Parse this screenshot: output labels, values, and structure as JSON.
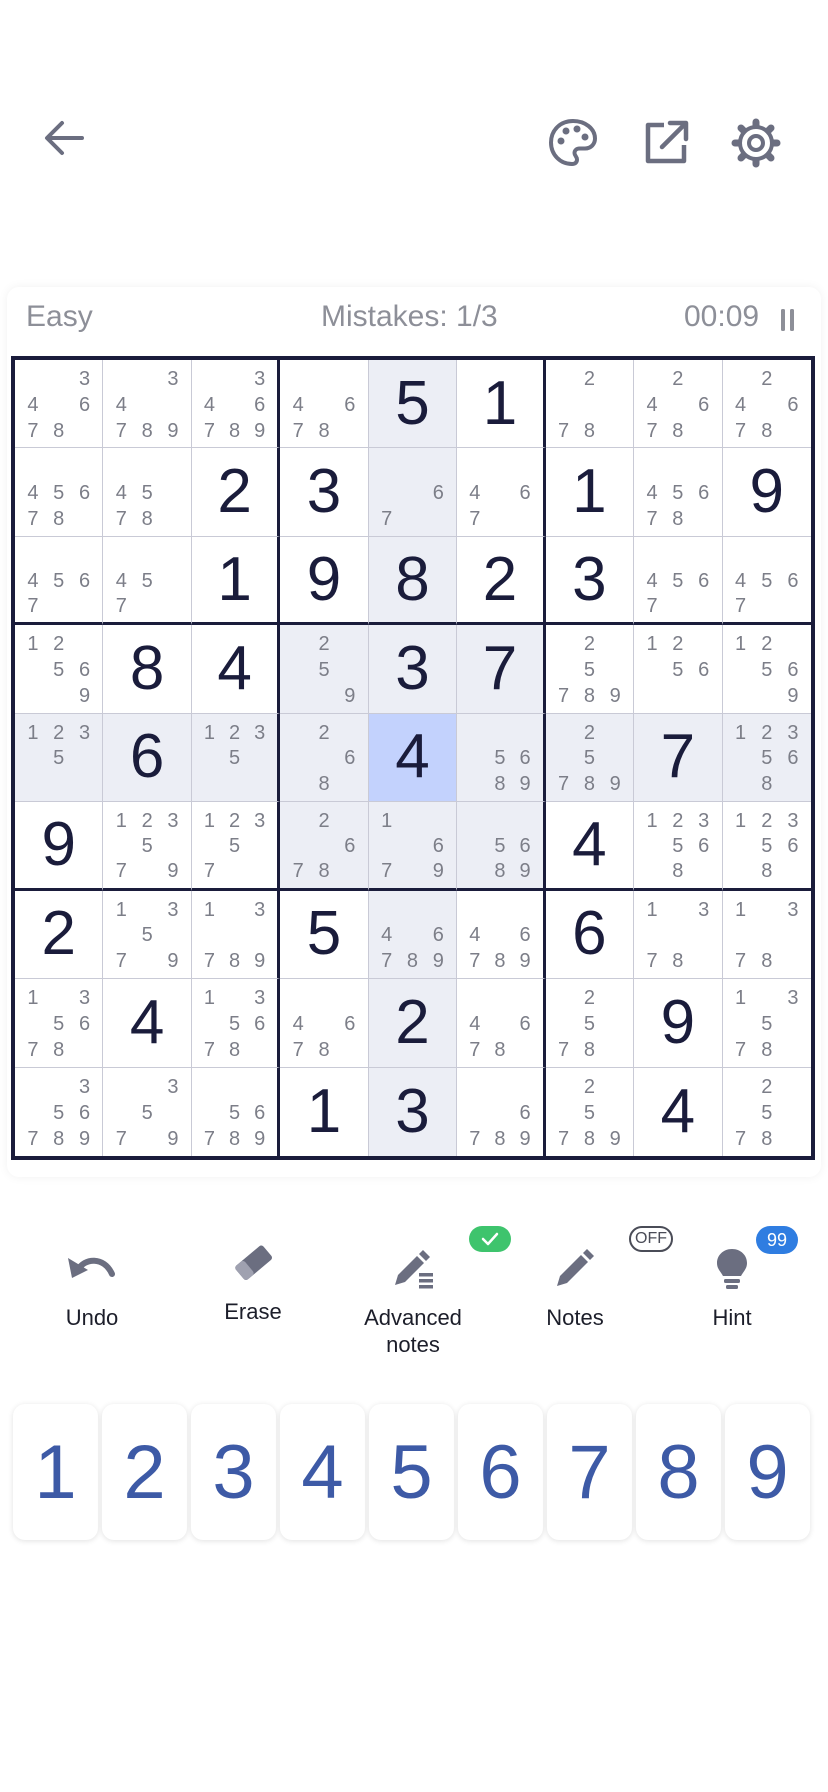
{
  "header": {
    "back_icon": "arrow-left-icon",
    "theme_icon": "palette-icon",
    "share_icon": "external-link-icon",
    "settings_icon": "gear-icon"
  },
  "status": {
    "difficulty": "Easy",
    "mistakes": "Mistakes: 1/3",
    "timer": "00:09",
    "pause_icon": "pause-icon"
  },
  "board": {
    "cells": [
      [
        {
          "n": [
            3,
            4,
            6,
            7,
            8
          ]
        },
        {
          "n": [
            3,
            4,
            7,
            8,
            9
          ]
        },
        {
          "n": [
            3,
            4,
            6,
            7,
            8,
            9
          ]
        },
        {
          "n": [
            4,
            6,
            7,
            8
          ]
        },
        {
          "v": "5"
        },
        {
          "v": "1"
        },
        {
          "n": [
            2,
            7,
            8
          ]
        },
        {
          "n": [
            2,
            4,
            6,
            7,
            8
          ]
        },
        {
          "n": [
            2,
            4,
            6,
            7,
            8
          ]
        }
      ],
      [
        {
          "n": [
            4,
            5,
            6,
            7,
            8
          ]
        },
        {
          "n": [
            4,
            5,
            7,
            8
          ]
        },
        {
          "v": "2"
        },
        {
          "v": "3"
        },
        {
          "n": [
            6,
            7
          ]
        },
        {
          "n": [
            4,
            6,
            7
          ]
        },
        {
          "v": "1"
        },
        {
          "n": [
            4,
            5,
            6,
            7,
            8
          ]
        },
        {
          "v": "9"
        }
      ],
      [
        {
          "n": [
            4,
            5,
            6,
            7
          ]
        },
        {
          "n": [
            4,
            5,
            7
          ]
        },
        {
          "v": "1"
        },
        {
          "v": "9"
        },
        {
          "v": "8"
        },
        {
          "v": "2"
        },
        {
          "v": "3"
        },
        {
          "n": [
            4,
            5,
            6,
            7
          ]
        },
        {
          "n": [
            4,
            5,
            6,
            7
          ]
        }
      ],
      [
        {
          "n": [
            1,
            2,
            5,
            6,
            9
          ]
        },
        {
          "v": "8"
        },
        {
          "v": "4"
        },
        {
          "n": [
            2,
            5,
            9
          ]
        },
        {
          "v": "3"
        },
        {
          "v": "7"
        },
        {
          "n": [
            2,
            5,
            7,
            8,
            9
          ]
        },
        {
          "n": [
            1,
            2,
            5,
            6
          ]
        },
        {
          "n": [
            1,
            2,
            5,
            6,
            9
          ]
        }
      ],
      [
        {
          "n": [
            1,
            2,
            3,
            5
          ]
        },
        {
          "v": "6"
        },
        {
          "n": [
            1,
            2,
            3,
            5
          ]
        },
        {
          "n": [
            2,
            6,
            8
          ]
        },
        {
          "v": "4"
        },
        {
          "n": [
            5,
            6,
            8,
            9
          ]
        },
        {
          "n": [
            2,
            5,
            7,
            8,
            9
          ]
        },
        {
          "v": "7"
        },
        {
          "n": [
            1,
            2,
            3,
            5,
            6,
            8
          ]
        }
      ],
      [
        {
          "v": "9"
        },
        {
          "n": [
            1,
            2,
            3,
            5,
            7,
            9
          ]
        },
        {
          "n": [
            1,
            2,
            3,
            5,
            7
          ]
        },
        {
          "n": [
            2,
            6,
            7,
            8
          ]
        },
        {
          "n": [
            1,
            6,
            7,
            9
          ]
        },
        {
          "n": [
            5,
            6,
            8,
            9
          ]
        },
        {
          "v": "4"
        },
        {
          "n": [
            1,
            2,
            3,
            5,
            6,
            8
          ]
        },
        {
          "n": [
            1,
            2,
            3,
            5,
            6,
            8
          ]
        }
      ],
      [
        {
          "v": "2"
        },
        {
          "n": [
            1,
            3,
            5,
            7,
            9
          ]
        },
        {
          "n": [
            1,
            3,
            7,
            8,
            9
          ]
        },
        {
          "v": "5"
        },
        {
          "n": [
            4,
            6,
            7,
            8,
            9
          ]
        },
        {
          "n": [
            4,
            6,
            7,
            8,
            9
          ]
        },
        {
          "v": "6"
        },
        {
          "n": [
            1,
            3,
            7,
            8
          ]
        },
        {
          "n": [
            1,
            3,
            7,
            8
          ]
        }
      ],
      [
        {
          "n": [
            1,
            3,
            5,
            6,
            7,
            8
          ]
        },
        {
          "v": "4"
        },
        {
          "n": [
            1,
            3,
            5,
            6,
            7,
            8
          ]
        },
        {
          "n": [
            4,
            6,
            7,
            8
          ]
        },
        {
          "v": "2"
        },
        {
          "n": [
            4,
            6,
            7,
            8
          ]
        },
        {
          "n": [
            2,
            5,
            7,
            8
          ]
        },
        {
          "v": "9"
        },
        {
          "n": [
            1,
            3,
            5,
            7,
            8
          ]
        }
      ],
      [
        {
          "n": [
            3,
            5,
            6,
            7,
            8,
            9
          ]
        },
        {
          "n": [
            3,
            5,
            7,
            9
          ]
        },
        {
          "n": [
            5,
            6,
            7,
            8,
            9
          ]
        },
        {
          "v": "1"
        },
        {
          "v": "3"
        },
        {
          "n": [
            6,
            7,
            8,
            9
          ]
        },
        {
          "n": [
            2,
            5,
            7,
            8,
            9
          ]
        },
        {
          "v": "4"
        },
        {
          "n": [
            2,
            5,
            7,
            8
          ]
        }
      ]
    ],
    "selected": [
      4,
      4
    ]
  },
  "tools": {
    "undo": {
      "label": "Undo",
      "icon": "undo-icon"
    },
    "erase": {
      "label": "Erase",
      "icon": "eraser-icon"
    },
    "advanced_notes": {
      "label": "Advanced notes",
      "icon": "advanced-notes-icon",
      "badge": "check"
    },
    "notes": {
      "label": "Notes",
      "icon": "pencil-icon",
      "badge": "OFF"
    },
    "hint": {
      "label": "Hint",
      "icon": "lightbulb-icon",
      "badge": "99"
    }
  },
  "numpad": [
    "1",
    "2",
    "3",
    "4",
    "5",
    "6",
    "7",
    "8",
    "9"
  ],
  "colors": {
    "accent": "#3d5aa6",
    "grid_line": "#1a1c3b",
    "selected_cell": "#c3d2fd",
    "highlight_cell": "#eceef5",
    "badge_green": "#3ec46d",
    "badge_blue": "#2f7de1"
  }
}
